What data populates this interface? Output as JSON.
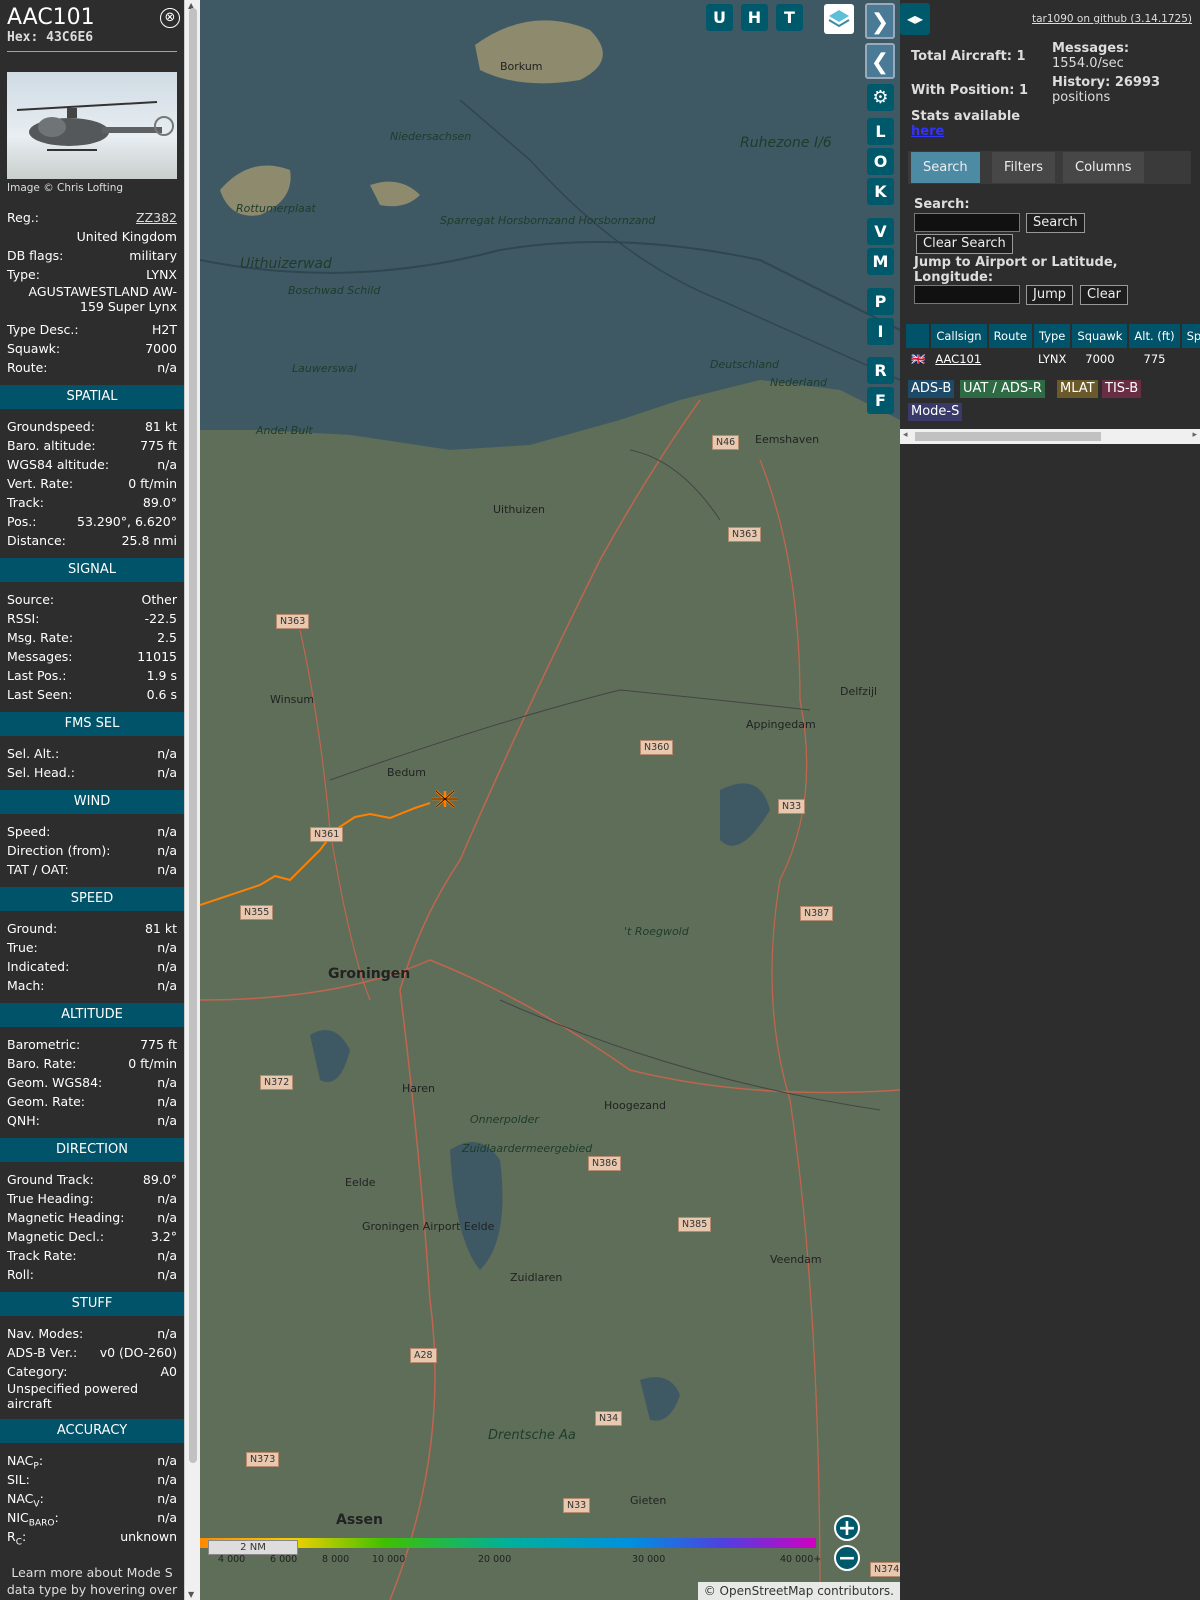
{
  "sidebar": {
    "callsign": "AAC101",
    "hex": "Hex: 43C6E6",
    "close_glyph": "⊗",
    "photo_credit": "Image © Chris Lofting",
    "reg_label": "Reg.:",
    "reg_value": "ZZ382",
    "country": "United Kingdom",
    "dbflags_label": "DB flags:",
    "dbflags_value": "military",
    "type_label": "Type:",
    "type_value": "LYNX",
    "type_full": "AGUSTAWESTLAND AW-159 Super Lynx",
    "typedesc_label": "Type Desc.:",
    "typedesc_value": "H2T",
    "squawk_label": "Squawk:",
    "squawk_value": "7000",
    "route_label": "Route:",
    "route_value": "n/a",
    "sections": {
      "spatial": "SPATIAL",
      "signal": "SIGNAL",
      "fms": "FMS SEL",
      "wind": "WIND",
      "speed": "SPEED",
      "altitude": "ALTITUDE",
      "direction": "DIRECTION",
      "stuff": "STUFF",
      "accuracy": "ACCURACY"
    },
    "spatial": [
      {
        "k": "Groundspeed:",
        "v": "81 kt"
      },
      {
        "k": "Baro. altitude:",
        "v": "775 ft"
      },
      {
        "k": "WGS84 altitude:",
        "v": "n/a"
      },
      {
        "k": "Vert. Rate:",
        "v": "0 ft/min"
      },
      {
        "k": "Track:",
        "v": "89.0°"
      },
      {
        "k": "Pos.:",
        "v": "53.290°, 6.620°"
      },
      {
        "k": "Distance:",
        "v": "25.8 nmi"
      }
    ],
    "signal": [
      {
        "k": "Source:",
        "v": "Other"
      },
      {
        "k": "RSSI:",
        "v": "-22.5"
      },
      {
        "k": "Msg. Rate:",
        "v": "2.5"
      },
      {
        "k": "Messages:",
        "v": "11015"
      },
      {
        "k": "Last Pos.:",
        "v": "1.9 s"
      },
      {
        "k": "Last Seen:",
        "v": "0.6 s"
      }
    ],
    "fms": [
      {
        "k": "Sel. Alt.:",
        "v": "n/a"
      },
      {
        "k": "Sel. Head.:",
        "v": "n/a"
      }
    ],
    "wind": [
      {
        "k": "Speed:",
        "v": "n/a"
      },
      {
        "k": "Direction (from):",
        "v": "n/a"
      },
      {
        "k": "TAT / OAT:",
        "v": "n/a"
      }
    ],
    "speed": [
      {
        "k": "Ground:",
        "v": "81 kt"
      },
      {
        "k": "True:",
        "v": "n/a"
      },
      {
        "k": "Indicated:",
        "v": "n/a"
      },
      {
        "k": "Mach:",
        "v": "n/a"
      }
    ],
    "altitude": [
      {
        "k": "Barometric:",
        "v": "775 ft"
      },
      {
        "k": "Baro. Rate:",
        "v": "0 ft/min"
      },
      {
        "k": "Geom. WGS84:",
        "v": "n/a"
      },
      {
        "k": "Geom. Rate:",
        "v": "n/a"
      },
      {
        "k": "QNH:",
        "v": "n/a"
      }
    ],
    "direction": [
      {
        "k": "Ground Track:",
        "v": "89.0°"
      },
      {
        "k": "True Heading:",
        "v": "n/a"
      },
      {
        "k": "Magnetic Heading:",
        "v": "n/a"
      },
      {
        "k": "Magnetic Decl.:",
        "v": "3.2°"
      },
      {
        "k": "Track Rate:",
        "v": "n/a"
      },
      {
        "k": "Roll:",
        "v": "n/a"
      }
    ],
    "stuff": [
      {
        "k": "Nav. Modes:",
        "v": "n/a"
      },
      {
        "k": "ADS-B Ver.:",
        "v": "v0 (DO-260)"
      },
      {
        "k": "Category:",
        "v": "A0"
      }
    ],
    "category_desc": "Unspecified powered aircraft",
    "accuracy": [
      {
        "k": "NAC",
        "sub": "P",
        "v": "n/a"
      },
      {
        "k": "SIL:",
        "sub": "",
        "v": "n/a"
      },
      {
        "k": "NAC",
        "sub": "V",
        "v": "n/a"
      },
      {
        "k": "NIC",
        "sub": "BARO",
        "v": "n/a"
      },
      {
        "k": "R",
        "sub": "C",
        "v": "unknown"
      }
    ],
    "footer": "Learn more about Mode S data type by hovering over each data label."
  },
  "map": {
    "layer_buttons": [
      "U",
      "H",
      "T"
    ],
    "side_buttons": [
      "L",
      "O",
      "K",
      "V",
      "M",
      "P",
      "I",
      "R",
      "F"
    ],
    "nav_next": "❯",
    "nav_prev": "❮",
    "zoom_in": "+",
    "zoom_out": "−",
    "scale": "2 NM",
    "attribution": "© OpenStreetMap contributors.",
    "altitude_legend": [
      "4 000",
      "6 000",
      "8 000",
      "10 000",
      "20 000",
      "30 000",
      "40 000+"
    ],
    "places": [
      {
        "name": "Borkum"
      },
      {
        "name": "Rottumerplaat"
      },
      {
        "name": "Uithuizerwad"
      },
      {
        "name": "Boschwad Schild"
      },
      {
        "name": "Sparregat Horsbornzand Horsbornzand"
      },
      {
        "name": "Ruhezone I/6"
      },
      {
        "name": "Lauwerswal"
      },
      {
        "name": "Andel Bult"
      },
      {
        "name": "Uithuizen"
      },
      {
        "name": "Eemshaven"
      },
      {
        "name": "Winsum"
      },
      {
        "name": "Bedum"
      },
      {
        "name": "Appingedam"
      },
      {
        "name": "Delfzijl"
      },
      {
        "name": "Groningen"
      },
      {
        "name": "Haren"
      },
      {
        "name": "Hoogezand"
      },
      {
        "name": "Eelde"
      },
      {
        "name": "Groningen Airport Eelde"
      },
      {
        "name": "Zuidlaren"
      },
      {
        "name": "Veendam"
      },
      {
        "name": "Drentsche Aa"
      },
      {
        "name": "Gieten"
      },
      {
        "name": "Assen"
      },
      {
        "name": "Onnerpolder"
      },
      {
        "name": "Zuidlaardermeergebied"
      },
      {
        "name": "'t Roegwold"
      },
      {
        "name": "Deutschland"
      },
      {
        "name": "Nederland"
      },
      {
        "name": "Niedersachsen"
      }
    ],
    "roads": [
      "N46",
      "N363",
      "N363",
      "N360",
      "N33",
      "N361",
      "N355",
      "N387",
      "N372",
      "N386",
      "N385",
      "A28",
      "N34",
      "N373",
      "N33",
      "N374"
    ]
  },
  "right": {
    "toggle_glyph": "◂▸",
    "github": "tar1090 on github (3.14.1725)",
    "total_aircraft": "Total Aircraft: 1",
    "with_position": "With Position: 1",
    "messages_label": "Messages:",
    "messages_value": "1554.0/sec",
    "history_label": "History: 26993",
    "history_value": "positions",
    "stats_text": "Stats available",
    "stats_link": "here",
    "tabs": [
      "Search",
      "Filters",
      "Columns"
    ],
    "search_label": "Search:",
    "search_button": "Search",
    "clear_search": "Clear Search",
    "jump_label": "Jump to Airport or Latitude, Longitude:",
    "jump_button": "Jump",
    "clear_button": "Clear",
    "table_headers": [
      "",
      "Callsign",
      "Route",
      "Type",
      "Squawk",
      "Alt. (ft)",
      "Spd."
    ],
    "table_rows": [
      {
        "flag": "🇬🇧",
        "callsign": "AAC101",
        "route": "",
        "type": "LYNX",
        "squawk": "7000",
        "alt": "775",
        "spd": ""
      }
    ],
    "sources": [
      "ADS-B",
      "UAT / ADS-R",
      "MLAT",
      "TIS-B",
      "Mode-S"
    ],
    "colors": {
      "adsb": "#1e4a6a",
      "uat": "#2e6a43",
      "mlat": "#6a5a2a",
      "tisb": "#6a2e44",
      "modes": "#3a3a6a"
    }
  }
}
